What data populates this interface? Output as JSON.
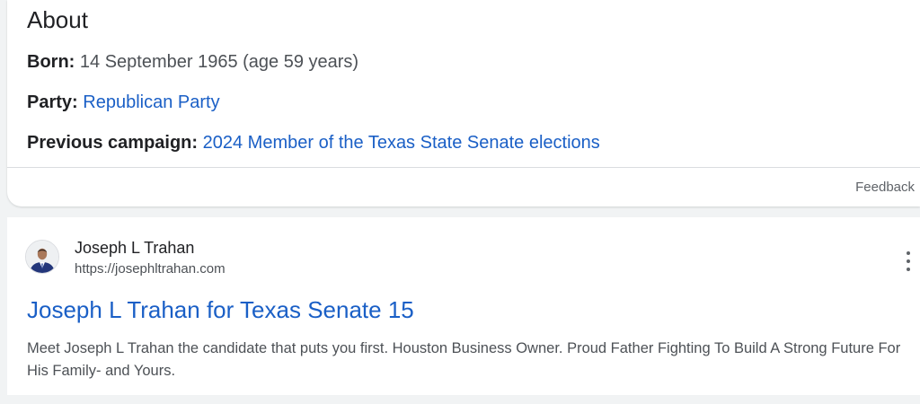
{
  "about": {
    "heading": "About",
    "born": {
      "label": "Born:",
      "value": "14 September 1965 (age 59 years)"
    },
    "party": {
      "label": "Party:",
      "value": "Republican Party"
    },
    "previous_campaign": {
      "label": "Previous campaign:",
      "value": "2024 Member of the Texas State Senate elections"
    },
    "feedback_label": "Feedback"
  },
  "result": {
    "site_name": "Joseph L Trahan",
    "site_url": "https://josephltrahan.com",
    "favicon_icon": "candidate-portrait-icon",
    "more_icon": "more-vert-icon",
    "title": "Joseph L Trahan for Texas Senate 15",
    "snippet": "Meet Joseph L Trahan the candidate that puts you first. Houston Business Owner. Proud Father Fighting To Build A Strong Future For His Family- and Yours."
  },
  "colors": {
    "link": "#1a5fc6",
    "text": "#202124",
    "secondary_text": "#4d5156",
    "page_background": "#f1f3f4"
  }
}
